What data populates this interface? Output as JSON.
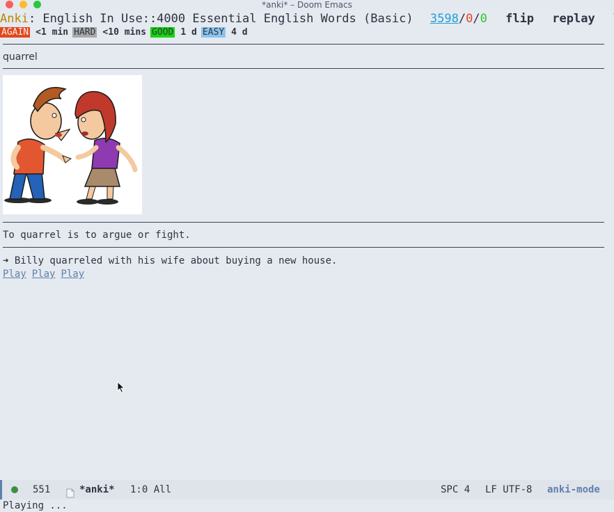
{
  "window": {
    "title": "*anki* – Doom Emacs"
  },
  "header": {
    "app": "Anki",
    "deck": ": English In Use::4000 Essential English Words (Basic)",
    "new_count": "3598",
    "learn_count": "0",
    "review_count": "0",
    "sep": "/",
    "actions": [
      "flip",
      "replay",
      "list"
    ]
  },
  "answer_buttons": [
    {
      "label": "AGAIN",
      "interval": "<1 min",
      "color": "#e2471c"
    },
    {
      "label": "HARD",
      "interval": "<10 mins",
      "color": "#a9a9a9"
    },
    {
      "label": "GOOD",
      "interval": "1 d",
      "color": "#16d40e"
    },
    {
      "label": "EASY",
      "interval": "4 d",
      "color": "#8bc4ee"
    }
  ],
  "card": {
    "word": "quarrel",
    "image_desc": "two cartoon people arguing",
    "definition": "To quarrel is to argue or fight.",
    "example": "➜ Billy quarreled with his wife about buying a new house.",
    "play_links": [
      "Play",
      "Play",
      "Play"
    ]
  },
  "modeline": {
    "count": "551",
    "buffer": "*anki*",
    "position": "1:0 All",
    "indent": "SPC 4",
    "encoding": "LF UTF-8",
    "mode": "anki-mode"
  },
  "echo_area": "Playing ..."
}
